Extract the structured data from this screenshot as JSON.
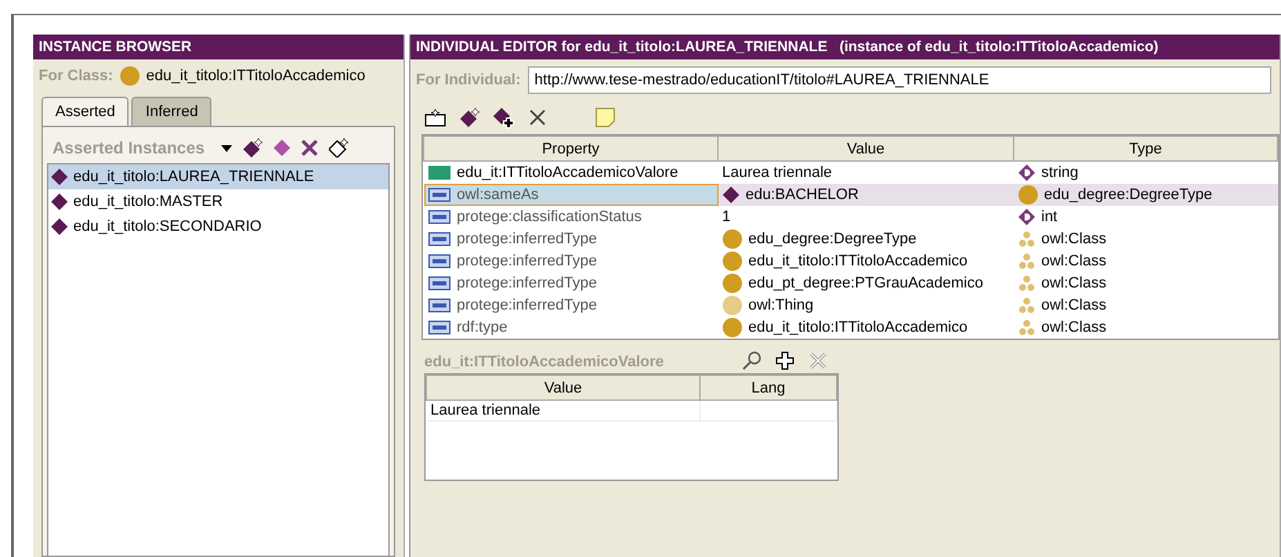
{
  "browser": {
    "title": "INSTANCE BROWSER",
    "for_class_label": "For Class:",
    "for_class_value": "edu_it_titolo:ITTitoloAccademico",
    "tabs": [
      {
        "label": "Asserted",
        "selected": true
      },
      {
        "label": "Inferred",
        "selected": false
      }
    ],
    "list_title": "Asserted Instances",
    "instances": [
      {
        "label": "edu_it_titolo:LAUREA_TRIENNALE",
        "selected": true
      },
      {
        "label": "edu_it_titolo:MASTER",
        "selected": false
      },
      {
        "label": "edu_it_titolo:SECONDARIO",
        "selected": false
      }
    ]
  },
  "editor": {
    "title": "INDIVIDUAL EDITOR for edu_it_titolo:LAUREA_TRIENNALE   (instance of edu_it_titolo:ITTitoloAccademico)",
    "for_individual_label": "For Individual:",
    "for_individual_value": "http://www.tese-mestrado/educationIT/titolo#LAUREA_TRIENNALE",
    "columns": [
      "Property",
      "Value",
      "Type"
    ],
    "rows": [
      {
        "property": {
          "text": "edu_it:ITTitoloAccademicoValore",
          "kind": "datatype"
        },
        "value": {
          "text": "Laurea triennale",
          "kind": "literal"
        },
        "type": {
          "text": "string",
          "kind": "datatype"
        },
        "selected": false
      },
      {
        "property": {
          "text": "owl:sameAs",
          "kind": "annotation"
        },
        "value": {
          "text": "edu:BACHELOR",
          "kind": "instance"
        },
        "type": {
          "text": "edu_degree:DegreeType",
          "kind": "class"
        },
        "selected": true
      },
      {
        "property": {
          "text": "protege:classificationStatus",
          "kind": "annotation"
        },
        "value": {
          "text": "1",
          "kind": "literal"
        },
        "type": {
          "text": "int",
          "kind": "datatype"
        },
        "selected": false
      },
      {
        "property": {
          "text": "protege:inferredType",
          "kind": "annotation"
        },
        "value": {
          "text": "edu_degree:DegreeType",
          "kind": "class"
        },
        "type": {
          "text": "owl:Class",
          "kind": "metaclass"
        },
        "selected": false
      },
      {
        "property": {
          "text": "protege:inferredType",
          "kind": "annotation"
        },
        "value": {
          "text": "edu_it_titolo:ITTitoloAccademico",
          "kind": "class"
        },
        "type": {
          "text": "owl:Class",
          "kind": "metaclass"
        },
        "selected": false
      },
      {
        "property": {
          "text": "protege:inferredType",
          "kind": "annotation"
        },
        "value": {
          "text": "edu_pt_degree:PTGrauAcademico",
          "kind": "class"
        },
        "type": {
          "text": "owl:Class",
          "kind": "metaclass"
        },
        "selected": false
      },
      {
        "property": {
          "text": "protege:inferredType",
          "kind": "annotation"
        },
        "value": {
          "text": "owl:Thing",
          "kind": "faded-class"
        },
        "type": {
          "text": "owl:Class",
          "kind": "metaclass"
        },
        "selected": false
      },
      {
        "property": {
          "text": "rdf:type",
          "kind": "annotation"
        },
        "value": {
          "text": "edu_it_titolo:ITTitoloAccademico",
          "kind": "class"
        },
        "type": {
          "text": "owl:Class",
          "kind": "metaclass"
        },
        "selected": false
      }
    ],
    "values_title": "edu_it:ITTitoloAccademicoValore",
    "values_columns": [
      "Value",
      "Lang"
    ],
    "values_rows": [
      {
        "value": "Laurea triennale"
      }
    ]
  }
}
